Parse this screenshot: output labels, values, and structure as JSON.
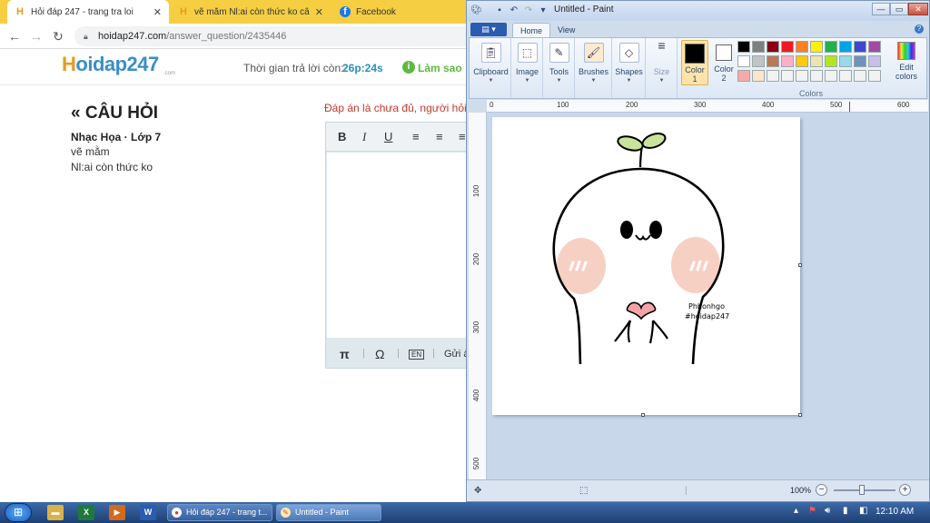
{
  "browser": {
    "tabs": [
      {
        "title": "Hỏi đáp 247 - trang tra loi",
        "favicon": "H",
        "favicon_color": "#e89a1d",
        "active": true
      },
      {
        "title": "vẽ mằm Nl:ai còn thức ko câu hỏi",
        "favicon": "H",
        "favicon_color": "#e89a1d",
        "active": false
      },
      {
        "title": "Facebook",
        "favicon": "f",
        "favicon_color": "#1877f2",
        "active": false
      }
    ],
    "tab_close": "✕",
    "url_host": "hoidap247.com",
    "url_path": "/answer_question/2435446",
    "accent": "#f5ce42"
  },
  "page": {
    "logo_main": "oidap247",
    "logo_h": "H",
    "logo_sub": ".com",
    "timer_label": "Thời gian trả lời còn:",
    "timer_value": "26p:24s",
    "help_link": "Làm sao",
    "question_heading": "« CÂU HỎI",
    "question_meta": "Nhạc Họa · Lớp 7",
    "question_line1": "vẽ mằm",
    "question_line2": "Nl:ai còn thức ko",
    "answer_note": "Đáp án là chưa đủ, người hỏi m",
    "editor_tools": [
      "B",
      "I",
      "U",
      "≡",
      "≡",
      "≡"
    ],
    "editor_bottom": [
      "π",
      "Ω",
      "EN",
      "Gửi ả"
    ]
  },
  "paint": {
    "title": "Untitled - Paint",
    "tabs": [
      "Home",
      "View"
    ],
    "groups": [
      "Clipboard",
      "Image",
      "Tools",
      "Brushes",
      "Shapes",
      "Size"
    ],
    "color1_label": "Color 1",
    "color2_label": "Color 2",
    "colors_label": "Colors",
    "edit_colors_label": "Edit colors",
    "color1": "#000000",
    "color2": "#ffffff",
    "palette": [
      "#000000",
      "#7f7f7f",
      "#880015",
      "#ed1c24",
      "#ff7f27",
      "#fff200",
      "#22b14c",
      "#00a2e8",
      "#3f48cc",
      "#a349a4",
      "#ffffff",
      "#c3c3c3",
      "#b97a57",
      "#ffaec9",
      "#ffc90e",
      "#efe4b0",
      "#b5e61d",
      "#99d9ea",
      "#7092be",
      "#c8bfe7",
      "#f7a9a9",
      "#ffe5c8",
      "#f2f2f2",
      "#f2f2f2",
      "#f2f2f2",
      "#f2f2f2",
      "#f2f2f2",
      "#f2f2f2",
      "#f2f2f2",
      "#f2f2f2"
    ],
    "ruler_h": [
      "0",
      "100",
      "200",
      "300",
      "400",
      "500",
      "600"
    ],
    "ruler_v": [
      "100",
      "200",
      "300",
      "400",
      "500"
    ],
    "drawing_text1": "Phhonhgo",
    "drawing_text2": "#hoidap247",
    "zoom": "100%"
  },
  "taskbar": {
    "tasks": [
      "Hỏi đáp 247 - trang t...",
      "Untitled - Paint"
    ],
    "clock": "12:10 AM"
  }
}
